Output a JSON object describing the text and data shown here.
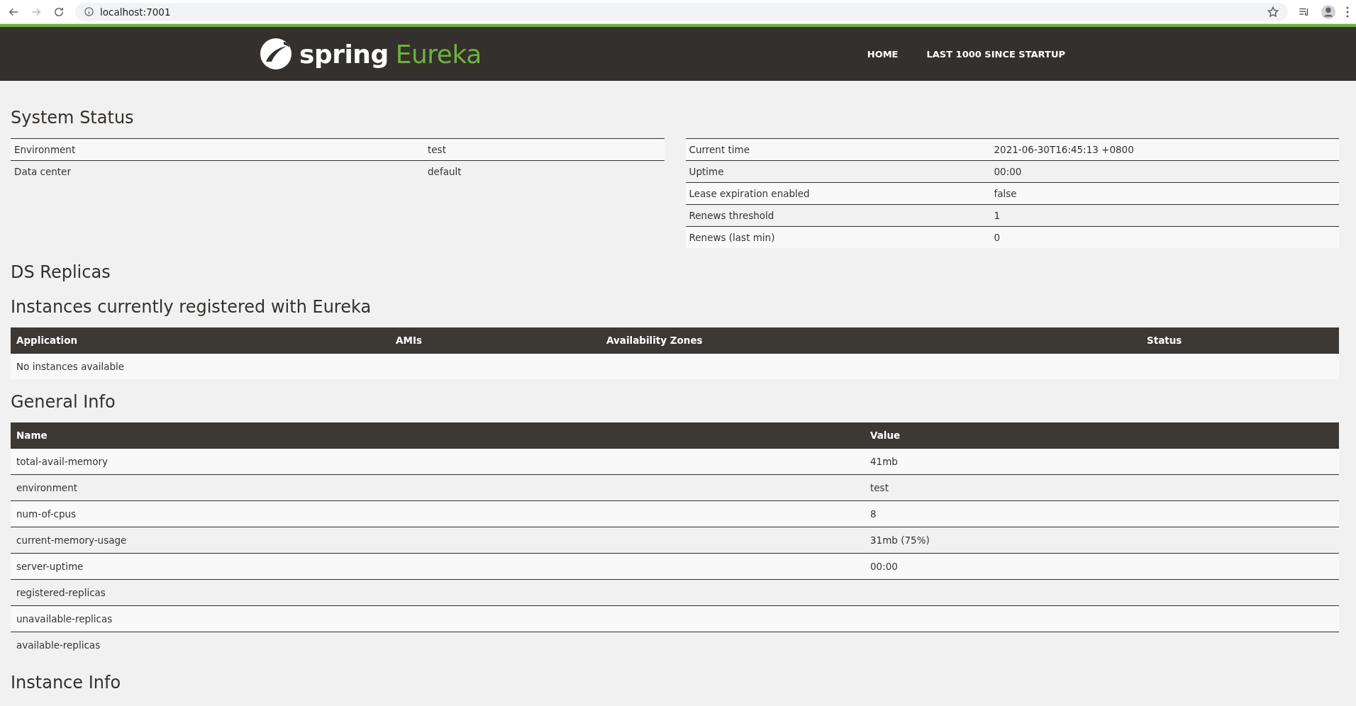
{
  "browser": {
    "url": "localhost:7001"
  },
  "header": {
    "brand": "spring",
    "product": "Eureka",
    "nav": [
      {
        "label": "HOME"
      },
      {
        "label": "LAST 1000 SINCE STARTUP"
      }
    ]
  },
  "system_status": {
    "title": "System Status",
    "left": [
      {
        "name": "Environment",
        "value": "test"
      },
      {
        "name": "Data center",
        "value": "default"
      }
    ],
    "right": [
      {
        "name": "Current time",
        "value": "2021-06-30T16:45:13 +0800"
      },
      {
        "name": "Uptime",
        "value": "00:00"
      },
      {
        "name": "Lease expiration enabled",
        "value": "false"
      },
      {
        "name": "Renews threshold",
        "value": "1"
      },
      {
        "name": "Renews (last min)",
        "value": "0"
      }
    ]
  },
  "ds_replicas": {
    "title": "DS Replicas"
  },
  "instances": {
    "title": "Instances currently registered with Eureka",
    "columns": [
      "Application",
      "AMIs",
      "Availability Zones",
      "Status"
    ],
    "empty": "No instances available"
  },
  "general_info": {
    "title": "General Info",
    "columns": [
      "Name",
      "Value"
    ],
    "rows": [
      {
        "name": "total-avail-memory",
        "value": "41mb"
      },
      {
        "name": "environment",
        "value": "test"
      },
      {
        "name": "num-of-cpus",
        "value": "8"
      },
      {
        "name": "current-memory-usage",
        "value": "31mb (75%)"
      },
      {
        "name": "server-uptime",
        "value": "00:00"
      },
      {
        "name": "registered-replicas"
      },
      {
        "name": "unavailable-replicas"
      },
      {
        "name": "available-replicas"
      }
    ]
  },
  "instance_info": {
    "title": "Instance Info"
  }
}
